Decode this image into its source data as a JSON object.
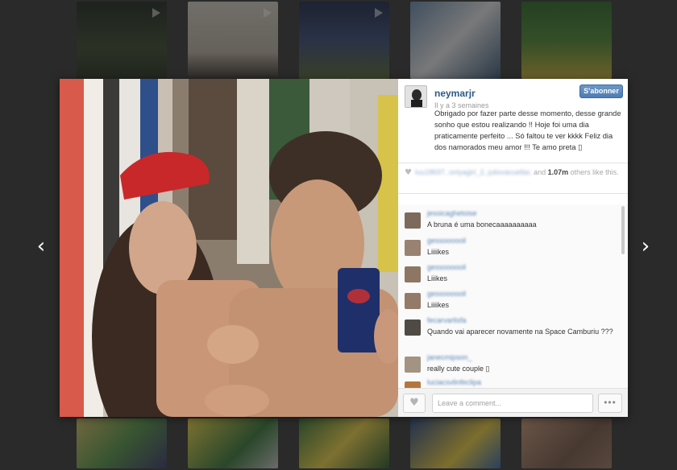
{
  "navigation": {
    "prev_arrow": "‹",
    "next_arrow": "›"
  },
  "post": {
    "username": "neymarjr",
    "timestamp": "Il y a 3 semaines",
    "follow_label": "S'abonner",
    "caption": "Obrigado por fazer parte desse momento, desse grande sonho que estou realizando !! Hoje foi uma dia praticamente perfeito ... Só faltou te ver kkkk Feliz dia dos namorados meu amor !!! Te amo preta ▯",
    "likes": {
      "heart_icon": "♥",
      "likers": "luu18697, onlyagirl_2, juliovacuellar,",
      "and_text": " and ",
      "count": "1.07m",
      "suffix": " others like this."
    }
  },
  "comments": [
    {
      "user": "jessicaghetoise",
      "text": "A bruna é uma bonecaaaaaaaaaa",
      "avatar_color": "#7d6a5c"
    },
    {
      "user": "gessoooooil",
      "text": "Liiiikes",
      "avatar_color": "#9a8270"
    },
    {
      "user": "gessoooooil",
      "text": "Liiikes",
      "avatar_color": "#8e7664"
    },
    {
      "user": "gessoooooil",
      "text": "Liiiikes",
      "avatar_color": "#937a69"
    },
    {
      "user": "fecarvarlisfa",
      "text": "Quando vai aparecer novamente na Space Camburiu ???",
      "avatar_color": "#4f4a44"
    },
    {
      "user": "janecmipson_",
      "text": "really cute couple  ▯",
      "avatar_color": "#a39383"
    },
    {
      "user": "luciacsvlinfeclipa",
      "text": "",
      "avatar_color": "#b3763f"
    }
  ],
  "footer": {
    "like_icon": "♥",
    "comment_placeholder": "Leave a comment...",
    "more_label": "•••"
  },
  "colors": {
    "username": "#2c5a85",
    "follow_button": "#5b88bb",
    "background": "#3a3a3a"
  }
}
